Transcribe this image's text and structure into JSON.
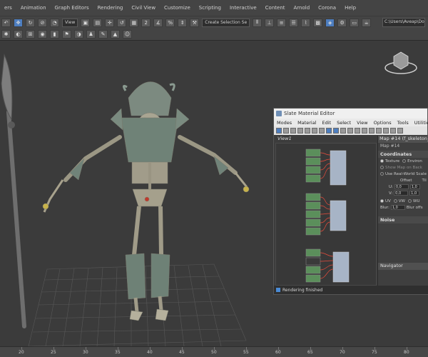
{
  "menu": [
    "ers",
    "Animation",
    "Graph Editors",
    "Rendering",
    "Civil View",
    "Customize",
    "Scripting",
    "Interactive",
    "Content",
    "Arnold",
    "Corona",
    "Help"
  ],
  "toolbar": {
    "view_dropdown": "View",
    "selection_set": "Create Selection Se",
    "path": "C:\\Users\\Aveap\\Docum"
  },
  "slate": {
    "title": "Slate Material Editor",
    "menu": [
      "Modes",
      "Material",
      "Edit",
      "Select",
      "View",
      "Options",
      "Tools",
      "Utilities"
    ],
    "view_tab": "View1",
    "status": "Rendering finished",
    "params": {
      "map_title": "Map #14 (f_skeleton_w",
      "map_name": "Map #14",
      "coordinates_label": "Coordinates",
      "texture_label": "Texture",
      "environ_label": "Environ",
      "show_map_on_back": "Show Map on Back",
      "use_real_world": "Use Real-World Scale",
      "offset_label": "Offset",
      "tile_label": "Til",
      "u_label": "U:",
      "u_value": "0,0",
      "v_label": "V:",
      "v_value": "0,0",
      "tile_u_value": "1,0",
      "tile_v_value": "1,0",
      "uv_label": "UV",
      "vw_label": "VW",
      "wu_label": "WU",
      "blur_label": "Blur:",
      "blur_value": "1,0",
      "blur_offset_label": "Blur offs",
      "noise_label": "Noise",
      "navigator_label": "Navigator"
    }
  },
  "timeline": {
    "ticks": [
      20,
      25,
      30,
      35,
      40,
      45,
      50,
      55,
      60,
      65,
      70,
      75,
      80,
      85,
      90,
      95
    ]
  },
  "colors": {
    "accent": "#4d7ec0",
    "ui_bg": "#444444",
    "viewport_bg": "#3b3b3b",
    "grid": "#5a5a5a"
  }
}
